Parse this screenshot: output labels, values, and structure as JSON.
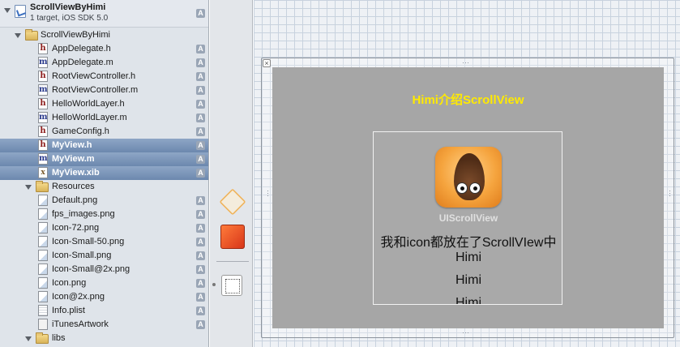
{
  "project": {
    "title": "ScrollViewByHimi",
    "subtitle": "1 target, iOS SDK 5.0",
    "badge": "A"
  },
  "navigator": {
    "items": [
      {
        "name": "ScrollViewByHimi",
        "kind": "folder",
        "badge": "",
        "selected": false
      },
      {
        "name": "AppDelegate.h",
        "kind": "h",
        "icon_letter": "h",
        "badge": "A",
        "selected": false
      },
      {
        "name": "AppDelegate.m",
        "kind": "m",
        "icon_letter": "m",
        "badge": "A",
        "selected": false
      },
      {
        "name": "RootViewController.h",
        "kind": "h",
        "icon_letter": "h",
        "badge": "A",
        "selected": false
      },
      {
        "name": "RootViewController.m",
        "kind": "m",
        "icon_letter": "m",
        "badge": "A",
        "selected": false
      },
      {
        "name": "HelloWorldLayer.h",
        "kind": "h",
        "icon_letter": "h",
        "badge": "A",
        "selected": false
      },
      {
        "name": "HelloWorldLayer.m",
        "kind": "m",
        "icon_letter": "m",
        "badge": "A",
        "selected": false
      },
      {
        "name": "GameConfig.h",
        "kind": "h",
        "icon_letter": "h",
        "badge": "A",
        "selected": false
      },
      {
        "name": "MyView.h",
        "kind": "h",
        "icon_letter": "h",
        "badge": "A",
        "selected": true
      },
      {
        "name": "MyView.m",
        "kind": "m",
        "icon_letter": "m",
        "badge": "A",
        "selected": true
      },
      {
        "name": "MyView.xib",
        "kind": "xib",
        "icon_letter": "x",
        "badge": "A",
        "selected": true
      },
      {
        "name": "Resources",
        "kind": "folder",
        "badge": "",
        "selected": false
      },
      {
        "name": "Default.png",
        "kind": "png",
        "badge": "A",
        "selected": false
      },
      {
        "name": "fps_images.png",
        "kind": "png",
        "badge": "A",
        "selected": false
      },
      {
        "name": "Icon-72.png",
        "kind": "png",
        "badge": "A",
        "selected": false
      },
      {
        "name": "Icon-Small-50.png",
        "kind": "png",
        "badge": "A",
        "selected": false
      },
      {
        "name": "Icon-Small.png",
        "kind": "png",
        "badge": "A",
        "selected": false
      },
      {
        "name": "Icon-Small@2x.png",
        "kind": "png",
        "badge": "A",
        "selected": false
      },
      {
        "name": "Icon.png",
        "kind": "png",
        "badge": "A",
        "selected": false
      },
      {
        "name": "Icon@2x.png",
        "kind": "png",
        "badge": "A",
        "selected": false
      },
      {
        "name": "Info.plist",
        "kind": "plist",
        "badge": "A",
        "selected": false
      },
      {
        "name": "iTunesArtwork",
        "kind": "art",
        "badge": "A",
        "selected": false
      },
      {
        "name": "libs",
        "kind": "folder",
        "badge": "",
        "selected": false
      }
    ]
  },
  "canvas": {
    "title_label": "Himi介绍ScrollView",
    "title_color": "#ffea00",
    "view_background": "#a6a6a6",
    "close_glyph": "×",
    "scroll_view": {
      "caption": "UIScrollView",
      "text": "我和icon都放在了ScrollVIew中",
      "lines": [
        "Himi",
        "Himi",
        "Himi"
      ]
    }
  }
}
